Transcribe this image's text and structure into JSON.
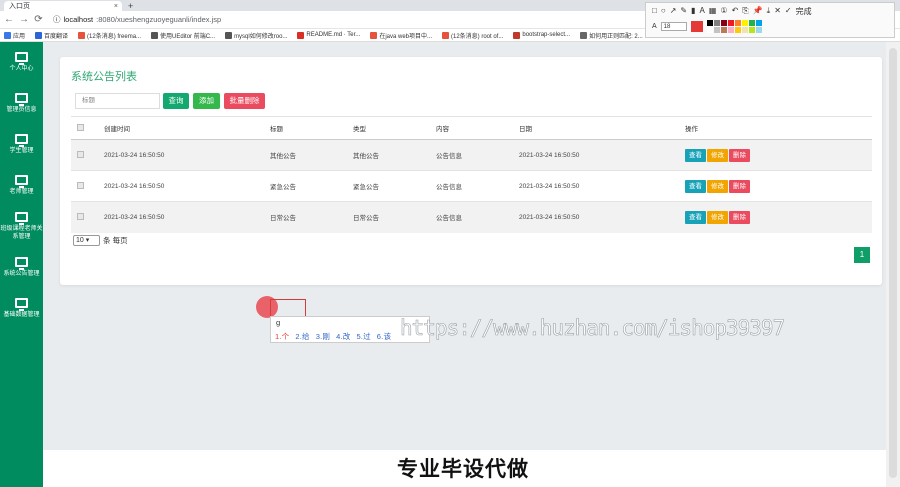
{
  "browser": {
    "tab_title": "入口页",
    "tab_close": "×",
    "new_tab": "+",
    "url_host": "localhost",
    "url_path": ":8080/xueshengzuoyeguanli/index.jsp",
    "bookmarks": [
      {
        "label": "应用",
        "color": "#3b78e7"
      },
      {
        "label": "百度翻译",
        "color": "#2a66d6"
      },
      {
        "label": "(12条消息) freema...",
        "color": "#e5533c"
      },
      {
        "label": "使用UEditor 前端C...",
        "color": "#555555"
      },
      {
        "label": "mysql如何修改roo...",
        "color": "#555555"
      },
      {
        "label": "README.md · Ter...",
        "color": "#d93025"
      },
      {
        "label": "在java web项目中...",
        "color": "#e5533c"
      },
      {
        "label": "(12条消息) root of...",
        "color": "#e5533c"
      },
      {
        "label": "bootstrap-select...",
        "color": "#c0392b"
      },
      {
        "label": "如何用正则匹配: 2...",
        "color": "#666666"
      }
    ]
  },
  "annotation_toolbar": {
    "finish_label": "完成",
    "font_letter": "A",
    "font_size": "18",
    "current_color": "#e53935",
    "palette": [
      "#000000",
      "#7f7f7f",
      "#880015",
      "#ed1c24",
      "#ff7f27",
      "#fff200",
      "#22b14c",
      "#00a2e8",
      "#ffffff",
      "#c3c3c3",
      "#b97a57",
      "#ffaec9",
      "#ffc90e",
      "#efe4b0",
      "#b5e61d",
      "#99d9ea"
    ]
  },
  "sidebar": {
    "items": [
      {
        "label": "个人中心"
      },
      {
        "label": "管理员信息"
      },
      {
        "label": "学生管理"
      },
      {
        "label": "老师管理"
      },
      {
        "label": "班级课程老师关系管理"
      },
      {
        "label": "系统公告管理"
      },
      {
        "label": "基础数据管理"
      }
    ]
  },
  "card": {
    "title": "系统公告列表",
    "search_placeholder": "标题",
    "buttons": {
      "search": "查询",
      "add": "添加",
      "batch_delete": "批量删除"
    }
  },
  "table": {
    "columns": [
      "创建时间",
      "标题",
      "类型",
      "内容",
      "日期",
      "操作"
    ],
    "rows": [
      {
        "created": "2021-03-24 16:50:50",
        "title": "其他公告",
        "type": "其他公告",
        "content": "公告信息",
        "date": "2021-03-24 16:50:50"
      },
      {
        "created": "2021-03-24 16:50:50",
        "title": "紧急公告",
        "type": "紧急公告",
        "content": "公告信息",
        "date": "2021-03-24 16:50:50"
      },
      {
        "created": "2021-03-24 16:50:50",
        "title": "日常公告",
        "type": "日常公告",
        "content": "公告信息",
        "date": "2021-03-24 16:50:50"
      }
    ],
    "actions": {
      "view": "查看",
      "edit": "修改",
      "delete": "删除"
    }
  },
  "pagination": {
    "page_size": "10",
    "per_page_label": "条 每页",
    "current_page": "1"
  },
  "ime": {
    "input": "g",
    "candidates": [
      "1.个",
      "2.给",
      "3.刚",
      "4.改",
      "5.过",
      "6.该"
    ]
  },
  "overlay": {
    "watermark": "https://www.huzhan.com/ishop39397",
    "caption": "专业毕设代做"
  }
}
